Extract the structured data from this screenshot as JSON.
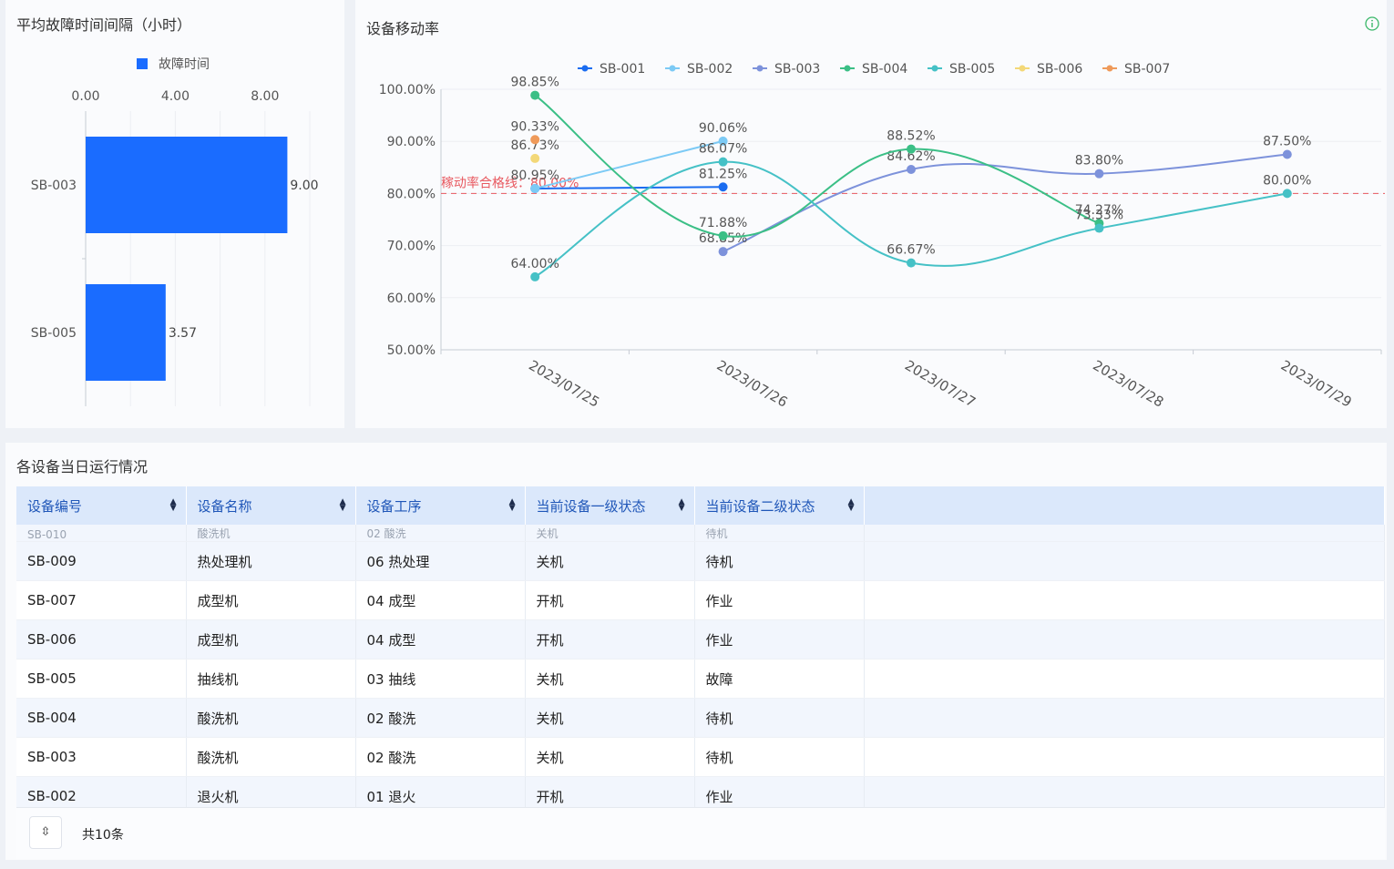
{
  "left_chart": {
    "title": "平均故障时间间隔（小时）",
    "legend": "故障时间",
    "axis_ticks": [
      "0.00",
      "4.00",
      "8.00"
    ],
    "bar_labels": [
      "9.00",
      "3.57"
    ],
    "color": "#1a6cff"
  },
  "right_chart": {
    "title": "设备移动率",
    "markline_label": "稼动率合格线：80.00%",
    "color_markline": "#e8585f"
  },
  "chart_data": [
    {
      "type": "bar",
      "orientation": "horizontal",
      "title": "平均故障时间间隔（小时）",
      "categories": [
        "SB-003",
        "SB-005"
      ],
      "series": [
        {
          "name": "故障时间",
          "values": [
            9.0,
            3.57
          ]
        }
      ],
      "xlim": [
        0,
        10
      ],
      "xticks": [
        "0.00",
        "4.00",
        "8.00"
      ],
      "legend": "top-center"
    },
    {
      "type": "line",
      "title": "设备移动率",
      "x": [
        "2023/07/25",
        "2023/07/26",
        "2023/07/27",
        "2023/07/28",
        "2023/07/29"
      ],
      "ylim": [
        50,
        100
      ],
      "yticks": [
        "50.00%",
        "60.00%",
        "70.00%",
        "80.00%",
        "90.00%",
        "100.00%"
      ],
      "legend": "top-center",
      "markline": {
        "value": 80,
        "label": "稼动率合格线：80.00%"
      },
      "series": [
        {
          "name": "SB-001",
          "color": "#1a6cf0",
          "values": [
            80.95,
            81.25,
            null,
            null,
            null
          ],
          "labels": [
            "80.95%",
            "81.25%"
          ]
        },
        {
          "name": "SB-002",
          "color": "#7ccaf5",
          "values": [
            80.95,
            90.06,
            null,
            null,
            null
          ],
          "labels": [
            "",
            "90.06%"
          ]
        },
        {
          "name": "SB-003",
          "color": "#7d92db",
          "values": [
            null,
            68.85,
            84.62,
            83.8,
            87.5
          ],
          "labels": [
            "",
            "68.85%",
            "84.62%",
            "83.80%",
            "87.50%"
          ]
        },
        {
          "name": "SB-004",
          "color": "#3bbf86",
          "values": [
            98.85,
            71.88,
            88.52,
            74.27,
            null
          ],
          "labels": [
            "98.85%",
            "71.88%",
            "88.52%",
            "74.27%"
          ]
        },
        {
          "name": "SB-005",
          "color": "#45c1c6",
          "values": [
            64.0,
            86.07,
            66.67,
            73.33,
            80.0
          ],
          "labels": [
            "64.00%",
            "86.07%",
            "66.67%",
            "73.33%",
            "80.00%"
          ]
        },
        {
          "name": "SB-006",
          "color": "#f3d878",
          "values": [
            86.73,
            null,
            null,
            null,
            null
          ],
          "labels": [
            "86.73%"
          ]
        },
        {
          "name": "SB-007",
          "color": "#ef9a5a",
          "values": [
            90.33,
            null,
            null,
            null,
            null
          ],
          "labels": [
            "90.33%"
          ]
        }
      ]
    }
  ],
  "table": {
    "title": "各设备当日运行情况",
    "columns": [
      "设备编号",
      "设备名称",
      "设备工序",
      "当前设备一级状态",
      "当前设备二级状态"
    ],
    "partial_row": [
      "SB-010",
      "酸洗机",
      "02 酸洗",
      "关机",
      "待机"
    ],
    "rows": [
      [
        "SB-009",
        "热处理机",
        "06 热处理",
        "关机",
        "待机"
      ],
      [
        "SB-007",
        "成型机",
        "04 成型",
        "开机",
        "作业"
      ],
      [
        "SB-006",
        "成型机",
        "04 成型",
        "开机",
        "作业"
      ],
      [
        "SB-005",
        "抽线机",
        "03 抽线",
        "关机",
        "故障"
      ],
      [
        "SB-004",
        "酸洗机",
        "02 酸洗",
        "关机",
        "待机"
      ],
      [
        "SB-003",
        "酸洗机",
        "02 酸洗",
        "关机",
        "待机"
      ],
      [
        "SB-002",
        "退火机",
        "01 退火",
        "开机",
        "作业"
      ]
    ],
    "total": "共10条"
  }
}
